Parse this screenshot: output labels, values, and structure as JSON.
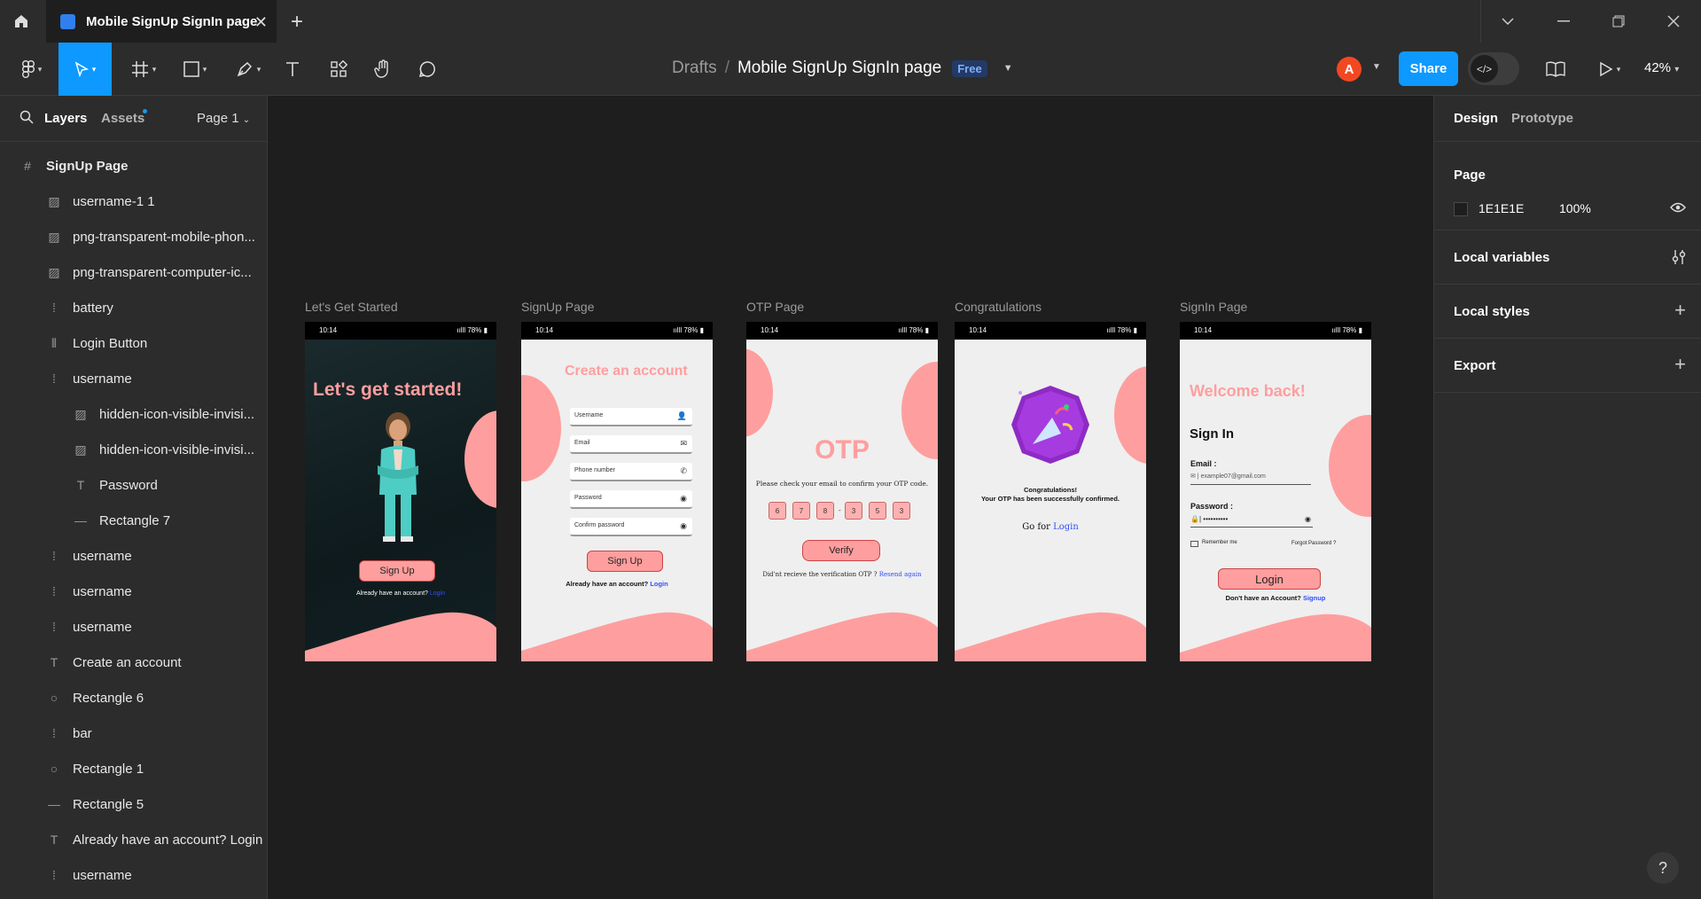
{
  "window": {
    "tab_title": "Mobile SignUp SignIn page",
    "new_tab": "+"
  },
  "toolbar": {
    "breadcrumb_drafts": "Drafts",
    "breadcrumb_sep": "/",
    "file_name": "Mobile SignUp SignIn page",
    "plan_badge": "Free",
    "avatar_initial": "A",
    "share_label": "Share",
    "zoom": "42%"
  },
  "left_panel": {
    "tab_layers": "Layers",
    "tab_assets": "Assets",
    "page_selector": "Page 1",
    "layers": [
      {
        "name": "SignUp Page",
        "icon": "frame-icon"
      },
      {
        "name": "username-1 1",
        "icon": "image-icon"
      },
      {
        "name": "png-transparent-mobile-phon...",
        "icon": "image-icon"
      },
      {
        "name": "png-transparent-computer-ic...",
        "icon": "image-icon"
      },
      {
        "name": "battery",
        "icon": "group-icon"
      },
      {
        "name": "Login Button",
        "icon": "auto-layout-icon"
      },
      {
        "name": "username",
        "icon": "group-icon"
      },
      {
        "name": "hidden-icon-visible-invisi...",
        "icon": "image-icon"
      },
      {
        "name": "hidden-icon-visible-invisi...",
        "icon": "image-icon"
      },
      {
        "name": "Password",
        "icon": "text-icon"
      },
      {
        "name": "Rectangle 7",
        "icon": "line-icon"
      },
      {
        "name": "username",
        "icon": "group-icon"
      },
      {
        "name": "username",
        "icon": "group-icon"
      },
      {
        "name": "username",
        "icon": "group-icon"
      },
      {
        "name": "Create an account",
        "icon": "text-icon"
      },
      {
        "name": "Rectangle 6",
        "icon": "ellipse-icon"
      },
      {
        "name": "bar",
        "icon": "group-icon"
      },
      {
        "name": "Rectangle 1",
        "icon": "ellipse-icon"
      },
      {
        "name": "Rectangle 5",
        "icon": "line-icon"
      },
      {
        "name": "Already have an account? Login",
        "icon": "text-icon"
      },
      {
        "name": "username",
        "icon": "group-icon"
      }
    ]
  },
  "right_panel": {
    "tab_design": "Design",
    "tab_prototype": "Prototype",
    "page_heading": "Page",
    "page_color": "1E1E1E",
    "page_opacity": "100%",
    "local_variables": "Local variables",
    "local_styles": "Local styles",
    "export": "Export"
  },
  "canvas": {
    "status_time": "10:14",
    "status_battery": "78%",
    "frames": [
      {
        "label": "Let's Get Started",
        "heading": "Let's get started!",
        "button": "Sign Up",
        "footer_text": "Already have an account?",
        "footer_link": "Login"
      },
      {
        "label": "SignUp Page",
        "heading": "Create an account",
        "fields": [
          "Username",
          "Email",
          "Phone number",
          "Password",
          "Confirm password"
        ],
        "button": "Sign Up",
        "footer_text": "Already have an account?",
        "footer_link": "Login"
      },
      {
        "label": "OTP Page",
        "heading": "OTP",
        "instruction": "Please check your email to confirm your OTP code.",
        "digits": [
          "6",
          "7",
          "8",
          "3",
          "5",
          "3"
        ],
        "button": "Verify",
        "footer_text": "Did'nt recieve the verification OTP ?",
        "footer_link": "Resend again"
      },
      {
        "label": "Congratulations",
        "line1": "Congratulations!",
        "line2": "Your OTP has been successfully confirmed.",
        "goto_text": "Go for",
        "goto_link": "Login"
      },
      {
        "label": "SignIn Page",
        "welcome": "Welcome back!",
        "heading": "Sign In",
        "email_label": "Email :",
        "email_placeholder": "example07@gmail.com",
        "password_label": "Password :",
        "password_value": "••••••••••",
        "remember": "Remember me",
        "forgot": "Forgot Password ?",
        "button": "Login",
        "footer_text": "Don't have an Account?",
        "footer_link": "Signup"
      }
    ]
  },
  "colors": {
    "accent": "#0d99ff",
    "canvas_bg": "#1e1e1e",
    "panel_bg": "#2c2c2c",
    "brand_pink": "#ff9e9e"
  }
}
